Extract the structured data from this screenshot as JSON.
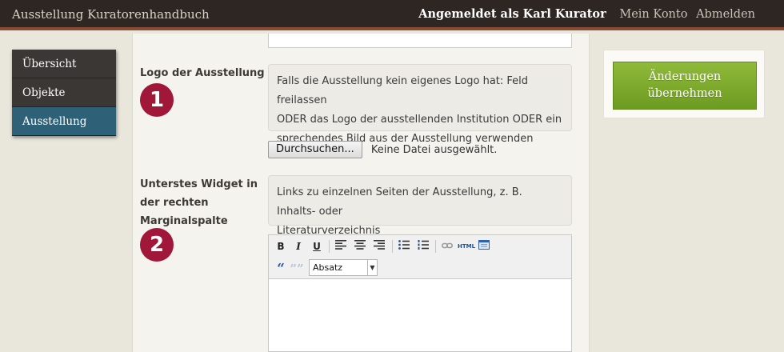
{
  "header": {
    "app_title": "Ausstellung Kuratorenhandbuch",
    "logged_in_text": "Angemeldet als Karl Kurator",
    "account_link": "Mein Konto",
    "logout_link": "Abmelden"
  },
  "sidebar": {
    "items": [
      {
        "label": "Übersicht",
        "active": false
      },
      {
        "label": "Objekte",
        "active": false
      },
      {
        "label": "Ausstellung",
        "active": true
      }
    ]
  },
  "form": {
    "logo_field": {
      "label": "Logo der Ausstellung",
      "badge": "1",
      "help_lines": [
        "Falls die Ausstellung kein eigenes Logo hat: Feld freilassen",
        "ODER das Logo der ausstellenden Institution ODER ein",
        "sprechendes Bild aus der Ausstellung verwenden"
      ],
      "browse_label": "Durchsuchen...",
      "file_status": "Keine Datei ausgewählt."
    },
    "widget_field": {
      "label_lines": [
        "Unterstes Widget in",
        "der rechten",
        "Marginalspalte"
      ],
      "badge": "2",
      "help_lines": [
        "Links zu einzelnen Seiten der Ausstellung, z. B. Inhalts- oder",
        "Literaturverzeichnis"
      ]
    },
    "editor": {
      "toolbar": {
        "bold": "B",
        "italic": "I",
        "underline": "U",
        "html": "HTML",
        "quote_open": "“",
        "quote_close": "””"
      },
      "format_selected": "Absatz"
    }
  },
  "actions": {
    "save_lines": [
      "Änderungen",
      "übernehmen"
    ]
  },
  "colors": {
    "accent_badge": "#a0173a",
    "sidebar_active": "#2e6178",
    "save_button": "#7aa82a",
    "topbar": "#2d2622"
  }
}
